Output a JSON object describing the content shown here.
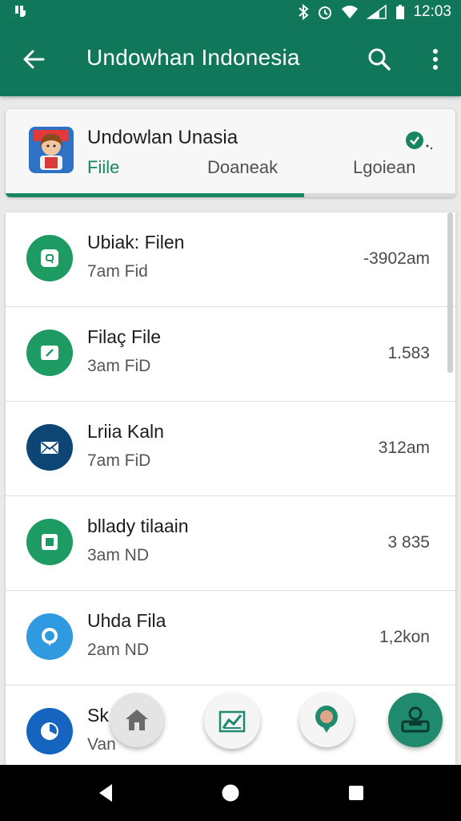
{
  "status_bar": {
    "time": "12:03",
    "icons": [
      "app-notification-icon",
      "bluetooth-icon",
      "alarm-icon",
      "wifi-icon",
      "cellular-signal-icon",
      "battery-icon"
    ]
  },
  "app_bar": {
    "title": "Undowhan Indonesia",
    "icons": [
      "back-arrow-icon",
      "search-icon",
      "more-vert-icon"
    ]
  },
  "profile": {
    "name": "Undowlan Unasia",
    "tabs": [
      {
        "label": "Fiile",
        "active": true
      },
      {
        "label": "Doaneak",
        "active": false
      },
      {
        "label": "Lgoiean",
        "active": false
      }
    ]
  },
  "files": [
    {
      "title": "Ubiak: Filen",
      "subtitle": "7am Fid",
      "value": "-3902am",
      "icon": "message-square-icon",
      "color": "#1e9a63"
    },
    {
      "title": "Filaç File",
      "subtitle": "3am FiD",
      "value": "1.583",
      "icon": "edit-square-icon",
      "color": "#1e9a63"
    },
    {
      "title": "Lriia Kaln",
      "subtitle": "7am FiD",
      "value": "312am",
      "icon": "mail-icon",
      "color": "#0d4674"
    },
    {
      "title": "bllady tilaain",
      "subtitle": "3am ND",
      "value": "3 835",
      "icon": "square-icon",
      "color": "#1e9a63"
    },
    {
      "title": "Uhda Fila",
      "subtitle": "2am ND",
      "value": "1,2kon",
      "icon": "chat-bubble-icon",
      "color": "#2f9ae0"
    },
    {
      "title": "Sk",
      "subtitle": "Van",
      "value": "",
      "icon": "pie-chart-icon",
      "color": "#1565c0"
    }
  ],
  "bottom_actions": [
    "home-icon",
    "chart-icon",
    "map-pin-icon",
    "profile-card-icon"
  ],
  "colors": {
    "primary": "#10775a",
    "accent": "#18865f",
    "fab_profile": "#1f8a6e"
  }
}
